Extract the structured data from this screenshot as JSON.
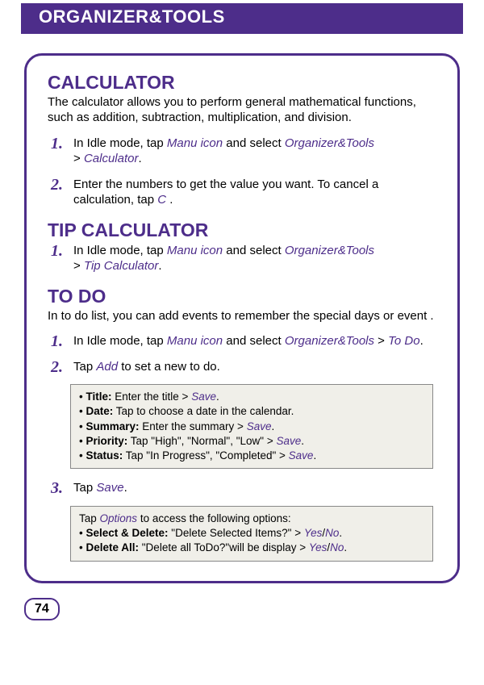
{
  "header": "ORGANIZER&TOOLS",
  "calculator": {
    "title": "CALCULATOR",
    "intro": "The calculator allows you to perform general mathematical functions, such as addition, subtraction, multiplication, and division.",
    "step1_a": "In Idle mode, tap ",
    "step1_manu": "Manu icon",
    "step1_b": " and select ",
    "step1_org": "Organizer&Tools",
    "step1_c": " > ",
    "step1_calc": "Calculator",
    "step1_d": ".",
    "step2_a": "Enter the numbers to get the value you want. To cancel a calculation, tap ",
    "step2_c": "C",
    "step2_d": " ."
  },
  "tip": {
    "title": "TIP CALCULATOR",
    "step1_a": "In Idle mode, tap ",
    "step1_manu": "Manu icon",
    "step1_b": " and select ",
    "step1_org": "Organizer&Tools",
    "step1_c": " > ",
    "step1_tip": "Tip Calculator",
    "step1_d": "."
  },
  "todo": {
    "title": "TO DO",
    "intro": "In to do list, you can add events to remember the special days or event .",
    "step1_a": "In Idle mode, tap ",
    "step1_manu": "Manu icon",
    "step1_b": " and select ",
    "step1_org": "Organizer&Tools",
    "step1_c": " > ",
    "step1_todo": "To Do",
    "step1_d": ".",
    "step2_a": "Tap ",
    "step2_add": "Add",
    "step2_b": " to set a new to do.",
    "box1": {
      "title_label": "Title:",
      "title_text_a": " Enter the title > ",
      "title_save": "Save",
      "title_text_b": ".",
      "date_label": "Date:",
      "date_text": " Tap to choose a date in the calendar.",
      "summary_label": "Summary:",
      "summary_text_a": " Enter the summary > ",
      "summary_save": "Save",
      "summary_text_b": ".",
      "priority_label": "Priority:",
      "priority_text_a": " Tap \"High\", \"Normal\", \"Low\" > ",
      "priority_save": "Save",
      "priority_text_b": ".",
      "status_label": "Status:",
      "status_text_a": " Tap \"In Progress\", \"Completed\" > ",
      "status_save": "Save",
      "status_text_b": "."
    },
    "step3_a": "Tap ",
    "step3_save": "Save",
    "step3_b": ".",
    "box2": {
      "line1_a": "Tap ",
      "line1_options": "Options",
      "line1_b": " to access the following options:",
      "sel_label": "Select & Delete:",
      "sel_text_a": " \"Delete Selected Items?\" > ",
      "sel_yes": "Yes",
      "sel_slash": "/",
      "sel_no": "No",
      "sel_text_b": ".",
      "del_label": "Delete All:",
      "del_text_a": " \"Delete all ToDo?\"will be display > ",
      "del_yes": "Yes",
      "del_slash": "/",
      "del_no": "No",
      "del_text_b": "."
    }
  },
  "page_number": "74"
}
